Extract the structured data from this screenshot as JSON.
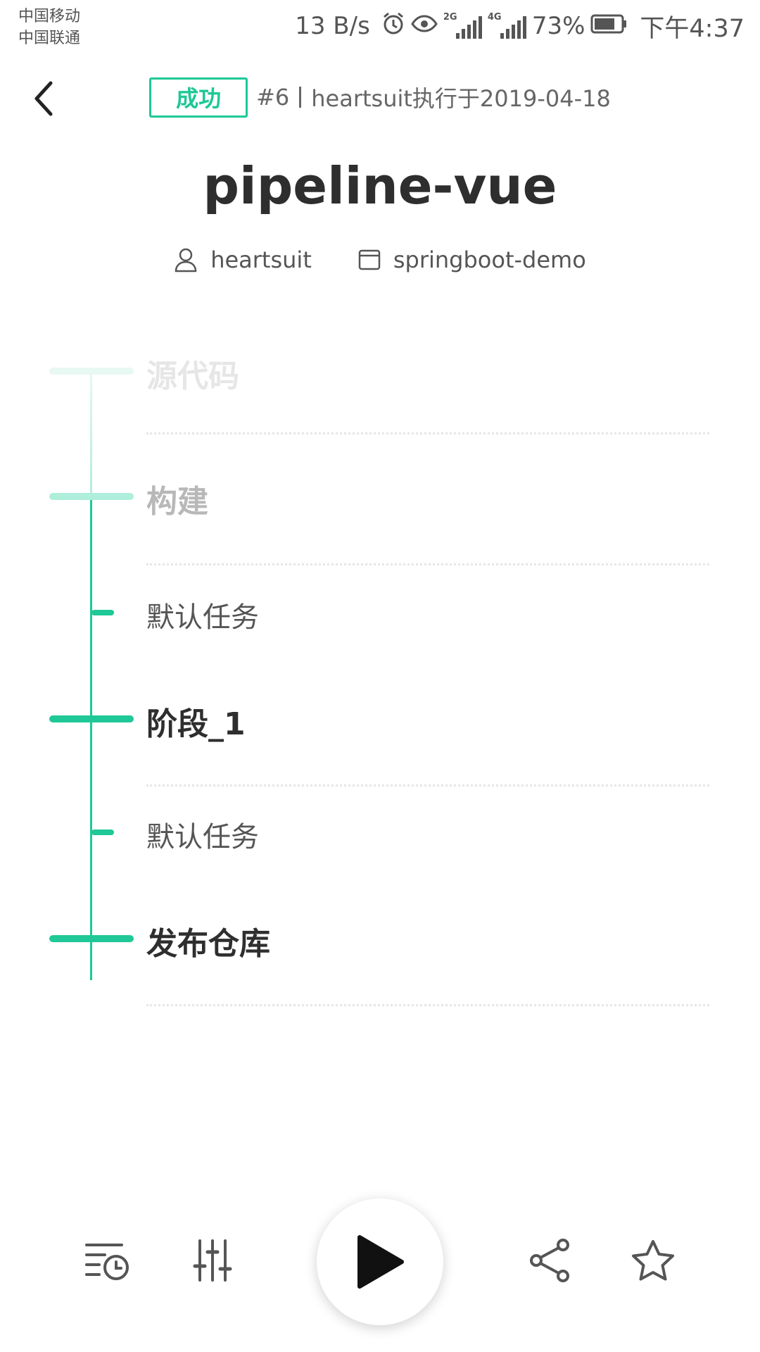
{
  "status_bar": {
    "carrier_1": "中国移动",
    "carrier_2": "中国联通",
    "net_speed": "13 B/s",
    "signal_1_label": "2G",
    "signal_2_label": "4G",
    "battery": "73%",
    "time": "下午4:37",
    "icons": [
      "alarm-icon",
      "eye-icon",
      "signal-icon",
      "battery-icon"
    ]
  },
  "header": {
    "status_badge": "成功",
    "run_number": "#6",
    "run_detail": "heartsuit执行于2019-04-18",
    "back_icon": "chevron-left-icon"
  },
  "pipeline": {
    "title": "pipeline-vue",
    "user": "heartsuit",
    "repo": "springboot-demo"
  },
  "timeline": {
    "stages": [
      {
        "label": "源代码",
        "tasks": []
      },
      {
        "label": "构建",
        "tasks": [
          "默认任务"
        ]
      },
      {
        "label": "阶段_1",
        "tasks": [
          "默认任务"
        ]
      },
      {
        "label": "发布仓库",
        "tasks": []
      }
    ]
  },
  "colors": {
    "accent": "#1fc896",
    "text": "#333333",
    "muted": "#666666"
  },
  "toolbar": {
    "icons": [
      "history-icon",
      "settings-sliders-icon",
      "play-icon",
      "share-icon",
      "star-icon"
    ]
  }
}
